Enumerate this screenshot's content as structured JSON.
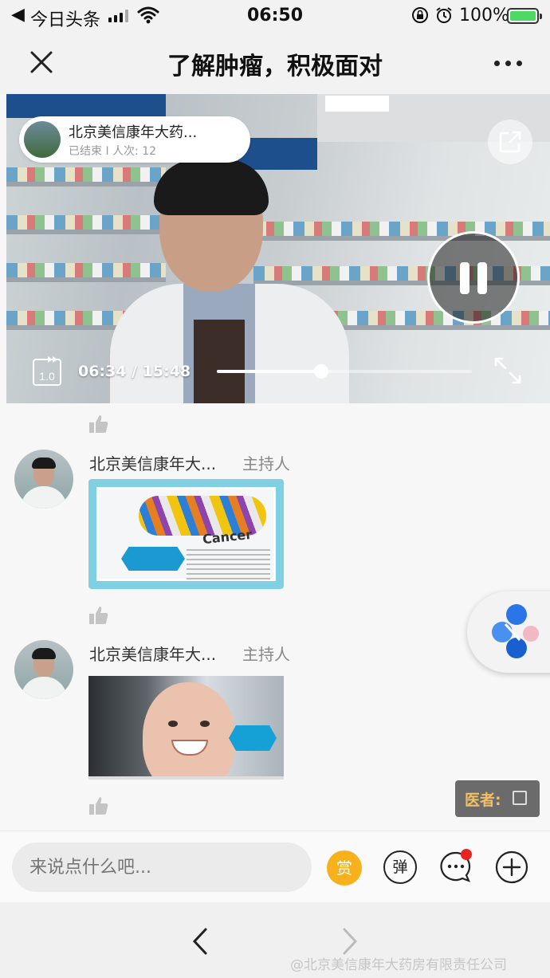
{
  "status_bar": {
    "back_app": "今日头条",
    "time": "06:50",
    "battery": "100%"
  },
  "nav": {
    "title": "了解肿瘤，积极面对"
  },
  "video": {
    "channel_name": "北京美信康年大药...",
    "channel_meta": "已结束 I 人次: 12",
    "speed": "1.0",
    "time": "06:34 / 15:48",
    "progress": 0.41
  },
  "messages": [
    {
      "name": "北京美信康年大...",
      "role": "主持人",
      "image_text": "Cancer"
    },
    {
      "name": "北京美信康年大...",
      "role": "主持人"
    }
  ],
  "doctor_toggle": {
    "label": "医者:"
  },
  "input": {
    "placeholder": "来说点什么吧...",
    "reward_label": "赏",
    "danmu_label": "弹"
  },
  "watermark": "@北京美信康年大药房有限责任公司",
  "colors": {
    "reward": "#f7b11d",
    "badge": "#e8241c",
    "card_border": "#7fd0e3",
    "doctor_label": "#f0c062"
  }
}
